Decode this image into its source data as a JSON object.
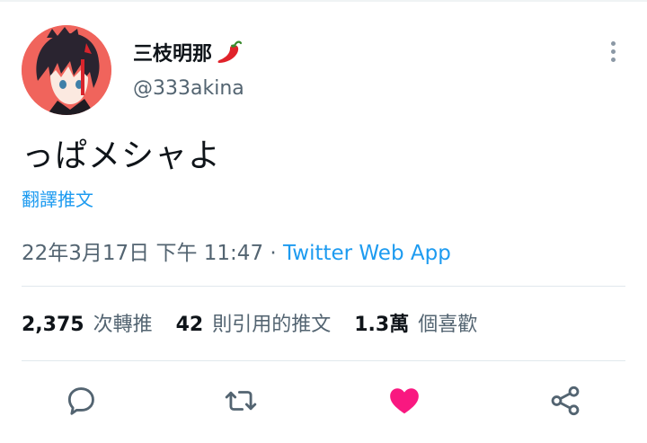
{
  "author": {
    "display_name": "三枝明那",
    "name_emoji_icon": "chili-pepper-icon",
    "handle": "@333akina",
    "avatar_icon": "anime-avatar",
    "avatar_bg": "#f0645c"
  },
  "tweet": {
    "text": "っぱメシャよ",
    "translate_label": "翻譯推文",
    "timestamp": "22年3月17日 下午 11:47 · ",
    "source": "Twitter Web App"
  },
  "stats": [
    {
      "count": "2,375",
      "label": "次轉推"
    },
    {
      "count": "42",
      "label": "則引用的推文"
    },
    {
      "count": "1.3萬",
      "label": "個喜歡"
    }
  ],
  "actions": {
    "reply_icon": "reply-icon",
    "retweet_icon": "retweet-icon",
    "like_icon": "heart-icon",
    "share_icon": "share-icon",
    "liked": true
  },
  "colors": {
    "link": "#1d9bf0",
    "like": "#f91880",
    "muted": "#536471",
    "text": "#0f1419"
  }
}
